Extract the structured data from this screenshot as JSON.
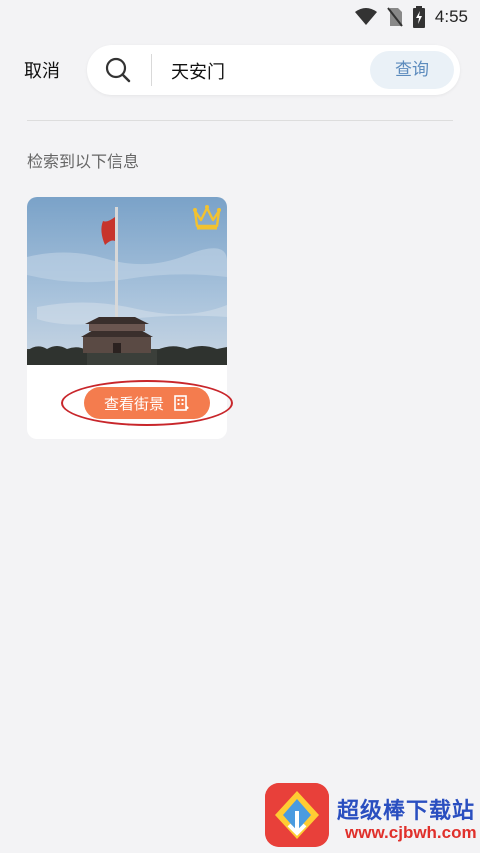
{
  "status_bar": {
    "time": "4:55",
    "icons": [
      "wifi-icon",
      "no-sim-icon",
      "battery-charging-icon"
    ]
  },
  "search": {
    "cancel_label": "取消",
    "query": "天安门",
    "submit_label": "查询"
  },
  "results": {
    "label": "检索到以下信息",
    "items": [
      {
        "image": "tiananmen-photo",
        "badge": "crown-icon",
        "button_label": "查看街景"
      }
    ]
  },
  "watermark": {
    "title": "超级棒下载站",
    "url": "www.cjbwh.com"
  },
  "colors": {
    "background": "#f3f3f5",
    "accent_orange": "#f47c4e",
    "query_button_text": "#5c8bbd",
    "annotation_red": "#c8262b"
  }
}
